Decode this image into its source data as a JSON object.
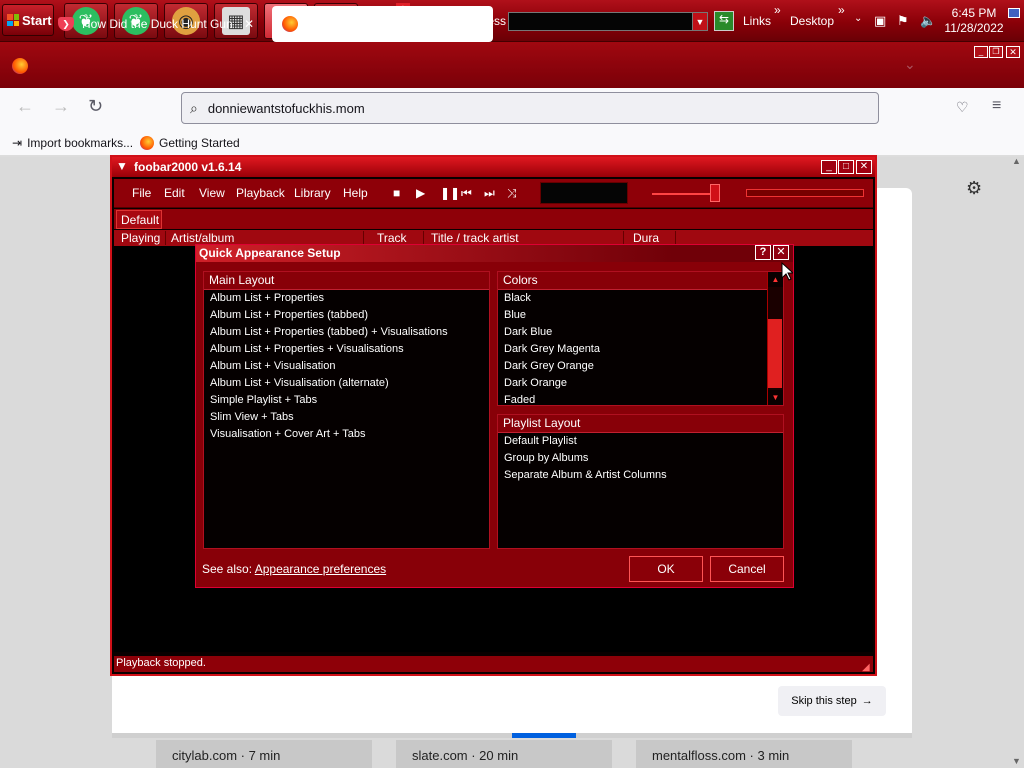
{
  "taskbar": {
    "start_label": "Start",
    "address_label": "Address",
    "address_value": "",
    "links_label": "Links",
    "desktop_label": "Desktop",
    "clock_time": "6:45 PM",
    "clock_date": "11/28/2022"
  },
  "browser": {
    "tab1_title": "How Did the Duck Hunt Gun Work?",
    "tab2_title": "",
    "url": "donniewantstofuckhis.mom",
    "bookmark1": "Import bookmarks...",
    "bookmark2": "Getting Started"
  },
  "page": {
    "skip_label": "Skip this step",
    "progress_fraction": 0.58,
    "stories": [
      "citylab.com · 7 min",
      "slate.com · 20 min",
      "mentalfloss.com · 3 min"
    ]
  },
  "foobar": {
    "title": "foobar2000 v1.6.14",
    "menu": [
      "File",
      "Edit",
      "View",
      "Playback",
      "Library",
      "Help"
    ],
    "tab": "Default",
    "columns": [
      "Playing",
      "Artist/album",
      "Track no",
      "Title / track artist",
      "Dura"
    ],
    "status": "Playback stopped."
  },
  "dialog": {
    "title": "Quick Appearance Setup",
    "help_label": "?",
    "close_label": "✕",
    "main_layout_header": "Main Layout",
    "main_layout_items": [
      "Album List + Properties",
      "Album List + Properties (tabbed)",
      "Album List + Properties (tabbed) + Visualisations",
      "Album List + Properties + Visualisations",
      "Album List + Visualisation",
      "Album List + Visualisation (alternate)",
      "Simple Playlist + Tabs",
      "Slim View + Tabs",
      "Visualisation + Cover Art + Tabs"
    ],
    "colors_header": "Colors",
    "colors_items": [
      "Black",
      "Blue",
      "Dark Blue",
      "Dark Grey Magenta",
      "Dark Grey Orange",
      "Dark Orange",
      "Faded"
    ],
    "playlist_header": "Playlist Layout",
    "playlist_items": [
      "Default Playlist",
      "Group by Albums",
      "Separate Album & Artist Columns"
    ],
    "see_also_label": "See also:",
    "see_also_link": "Appearance preferences",
    "ok_label": "OK",
    "cancel_label": "Cancel"
  },
  "colors": {
    "accent_red": "#d01018",
    "taskbar_red": "#8a0008",
    "dialog_red": "#880008",
    "firefox_blue": "#0060df"
  }
}
